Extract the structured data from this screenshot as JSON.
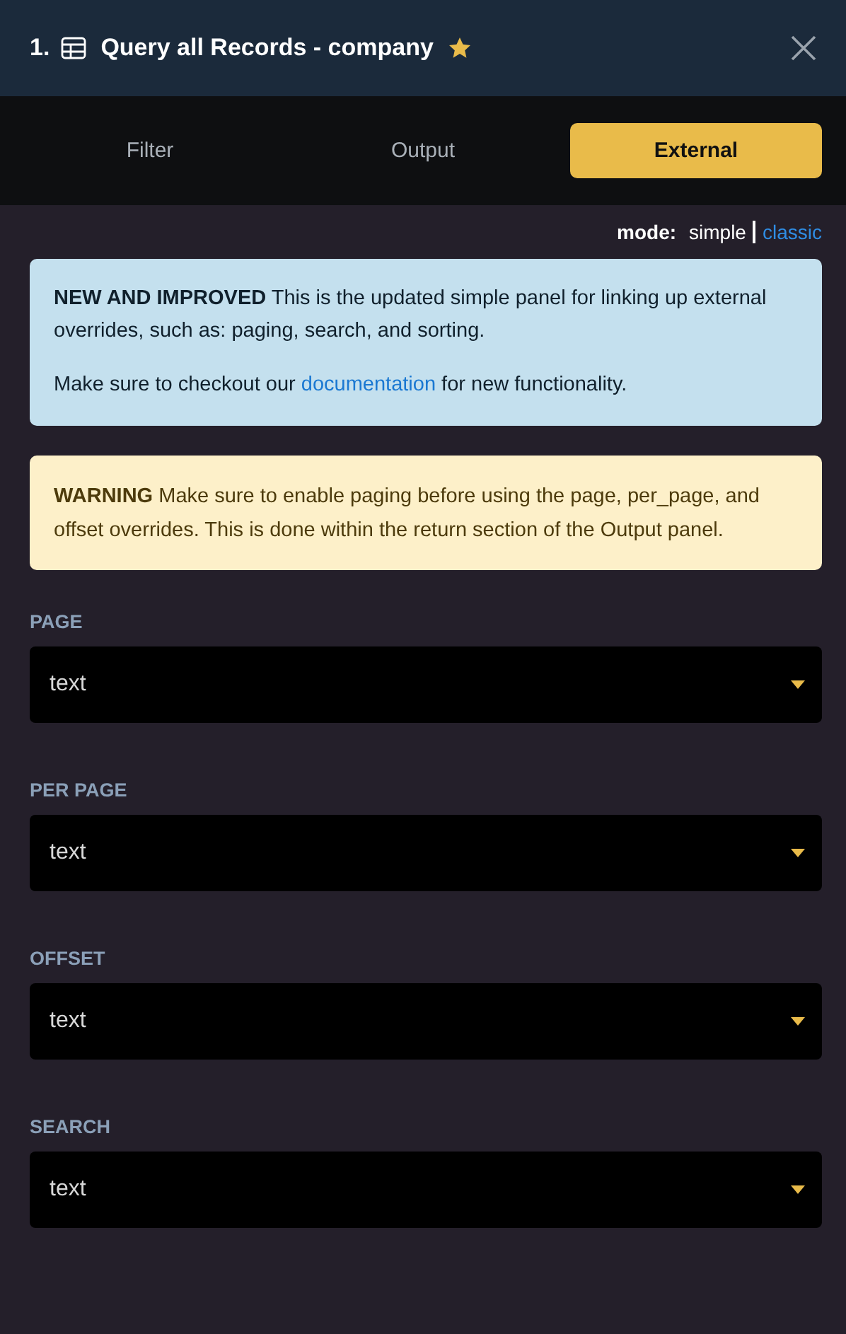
{
  "header": {
    "number": "1.",
    "title": "Query all Records - company",
    "starred": true
  },
  "tabs": [
    {
      "label": "Filter",
      "selected": false
    },
    {
      "label": "Output",
      "selected": false
    },
    {
      "label": "External",
      "selected": true
    }
  ],
  "mode": {
    "label": "mode:",
    "options": [
      {
        "label": "simple",
        "selected": true
      },
      {
        "label": "classic",
        "selected": false
      }
    ]
  },
  "info": {
    "text": "**NEW AND IMPROVED** This is the updated simple panel for linking up external overrides, such as: paging, search, and sorting.",
    "before_link": "Make sure to checkout our",
    "link": "documentation",
    "after_link": "for new functionality."
  },
  "warning": {
    "text": "**WARNING** Make sure to enable paging before using the page, per_page, and offset overrides. This is done within the return section of the Output panel."
  },
  "fields": [
    {
      "label": "PAGE",
      "value": "text"
    },
    {
      "label": "PER PAGE",
      "value": "text"
    },
    {
      "label": "OFFSET",
      "value": "text"
    },
    {
      "label": "SEARCH",
      "value": "text"
    }
  ]
}
